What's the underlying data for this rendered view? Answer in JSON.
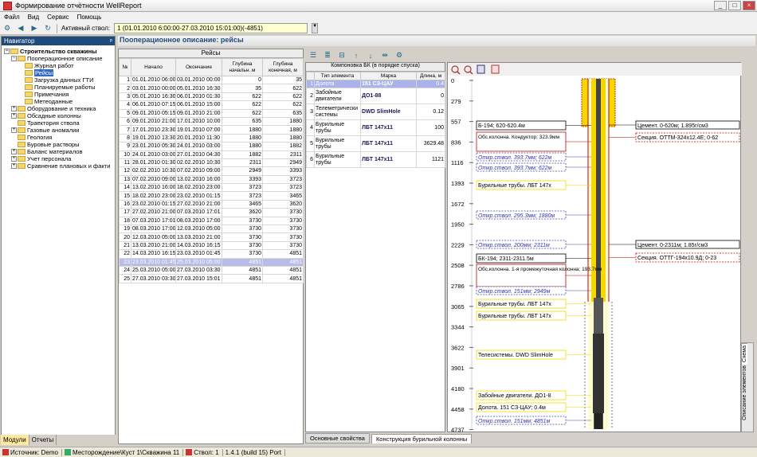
{
  "window": {
    "title": "Формирование отчётности WellReport"
  },
  "menu": [
    "Файл",
    "Вид",
    "Сервис",
    "Помощь"
  ],
  "toolbar": {
    "active_label": "Активный ствол:",
    "active_value": "1 (01.01.2010 6:00:00-27.03.2010 15:01:00)(-4851)"
  },
  "navigator": {
    "title": "Навигатор",
    "pin": "ᵖ",
    "items": [
      {
        "label": "Строительство скважины",
        "level": 0,
        "pm": "−",
        "bold": true
      },
      {
        "label": "Пооперационное описание",
        "level": 1,
        "pm": "−"
      },
      {
        "label": "Журнал работ",
        "level": 2
      },
      {
        "label": "Рейсы",
        "level": 2,
        "selected": true
      },
      {
        "label": "Загрузка данных ГТИ",
        "level": 2
      },
      {
        "label": "Планируемые работы",
        "level": 2
      },
      {
        "label": "Примечания",
        "level": 2
      },
      {
        "label": "Метеоданные",
        "level": 2
      },
      {
        "label": "Оборудование и техника",
        "level": 1,
        "pm": "+"
      },
      {
        "label": "Обсадные колонны",
        "level": 1,
        "pm": "+"
      },
      {
        "label": "Траектория ствола",
        "level": 1
      },
      {
        "label": "Газовые аномалии",
        "level": 1,
        "pm": "+"
      },
      {
        "label": "Геология",
        "level": 1
      },
      {
        "label": "Буровые растворы",
        "level": 1
      },
      {
        "label": "Баланс материалов",
        "level": 1,
        "pm": "+"
      },
      {
        "label": "Учет персонала",
        "level": 1,
        "pm": "+"
      },
      {
        "label": "Сравнение плановых и факти",
        "level": 1,
        "pm": "+"
      }
    ],
    "tabs": [
      "Модули",
      "Отчеты"
    ]
  },
  "page_title": "Пооперационное описание: рейсы",
  "trips": {
    "title": "Рейсы",
    "columns": [
      "№",
      "Начало",
      "Окончание",
      "Глубина начальн. м",
      "Глубина конечная, м"
    ],
    "rows": [
      [
        "1",
        "01.01.2010 06:00",
        "03.01.2010 00:00",
        "0",
        "35"
      ],
      [
        "2",
        "03.01.2010 00:00",
        "05.01.2010 16:30",
        "35",
        "622"
      ],
      [
        "3",
        "05.01.2010 16:30",
        "06.01.2010 01:30",
        "622",
        "622"
      ],
      [
        "4",
        "06.01.2010 07:15",
        "06.01.2010 15:00",
        "622",
        "622"
      ],
      [
        "5",
        "09.01.2010 05:15",
        "09.01.2010 21:00",
        "622",
        "635"
      ],
      [
        "6",
        "09.01.2010 21:00",
        "17.01.2010 10:00",
        "635",
        "1880"
      ],
      [
        "7",
        "17.01.2010 23:30",
        "19.01.2010 07:00",
        "1880",
        "1880"
      ],
      [
        "8",
        "19.01.2010 13:30",
        "20.01.2010 11:30",
        "1880",
        "1880"
      ],
      [
        "9",
        "23.01.2010 05:30",
        "24.01.2010 03:00",
        "1880",
        "1882"
      ],
      [
        "10",
        "24.01.2010 03:00",
        "27.01.2010 04:30",
        "1882",
        "2311"
      ],
      [
        "11",
        "28.01.2010 01:30",
        "02.02.2010 10:30",
        "2311",
        "2949"
      ],
      [
        "12",
        "02.02.2010 10:30",
        "07.02.2010 09:00",
        "2949",
        "3393"
      ],
      [
        "13",
        "07.02.2010 09:00",
        "13.02.2010 16:00",
        "3393",
        "3723"
      ],
      [
        "14",
        "13.02.2010 16:00",
        "18.02.2010 23:00",
        "3723",
        "3723"
      ],
      [
        "15",
        "18.02.2010 23:00",
        "23.02.2010 01:15",
        "3723",
        "3465"
      ],
      [
        "16",
        "23.02.2010 01:15",
        "27.02.2010 21:00",
        "3465",
        "3620"
      ],
      [
        "17",
        "27.02.2010 21:00",
        "07.03.2010 17:01",
        "3620",
        "3730"
      ],
      [
        "18",
        "07.03.2010 17:01",
        "08.03.2010 17:00",
        "3730",
        "3730"
      ],
      [
        "19",
        "08.03.2010 17:00",
        "12.03.2010 05:00",
        "3730",
        "3730"
      ],
      [
        "20",
        "12.03.2010 05:00",
        "13.03.2010 21:00",
        "3730",
        "3730"
      ],
      [
        "21",
        "13.03.2010 21:00",
        "14.03.2010 16:15",
        "3730",
        "3730"
      ],
      [
        "22",
        "14.03.2010 16:15",
        "23.03.2010 01:45",
        "3730",
        "4851"
      ],
      [
        "23",
        "23.03.2010 01:45",
        "25.03.2010 05:00",
        "4851",
        "4851"
      ],
      [
        "24",
        "25.03.2010 05:00",
        "27.03.2010 03:30",
        "4851",
        "4851"
      ],
      [
        "25",
        "27.03.2010 03:30",
        "27.03.2010 15:01",
        "4851",
        "4851"
      ]
    ],
    "selected_row": 22
  },
  "bha": {
    "title": "Компоновка БК (в порядке спуска)",
    "columns": [
      "",
      "Тип элемента",
      "Марка",
      "Длина, м"
    ],
    "rows": [
      [
        "1",
        "Долота",
        "151 СЗ-ЦАУ",
        "0.4"
      ],
      [
        "2",
        "Забойные двигатели",
        "ДО1-88",
        "0"
      ],
      [
        "3",
        "Телеметрически системы",
        "DWD SlimHole",
        "0.12"
      ],
      [
        "4",
        "Бурильные трубы",
        "ЛБТ 147х11",
        "100"
      ],
      [
        "5",
        "Бурильные трубы",
        "ЛБТ 147х11",
        "3629.48"
      ],
      [
        "6",
        "Бурильные трубы",
        "ЛБТ 147х11",
        "1121"
      ]
    ],
    "selected_row": 0
  },
  "scheme": {
    "depths": [
      "0",
      "279",
      "557",
      "836",
      "1116",
      "1393",
      "1672",
      "1950",
      "2229",
      "2508",
      "2786",
      "3065",
      "3344",
      "3622",
      "3901",
      "4180",
      "4458",
      "4737"
    ],
    "labels": {
      "b194": "Б-194; 620-620.4м",
      "casing1": "Обс.колонна. Кондуктор; 323.9мм",
      "hole393a": "Откр.ствол. 393.7мм; 622м",
      "hole393b": "Откр.ствол. 393.7мм; 622м",
      "pipe1": "Бурильные трубы. ЛБТ 147х",
      "hole295": "Откр.ствол. 295.3мм; 1880м",
      "hole200": "Откр.ствол. 200мм; 2311м",
      "bk194": "БК-194; 2311-2311.5м",
      "casing2": "Обс.колонна. 1-я промежуточная колонна; 193.7мм",
      "hole151a": "Откр.ствол. 151мм; 2949м",
      "pipe2": "Бурильные трубы. ЛБТ 147х",
      "pipe3": "Бурильные трубы. ЛБТ 147х",
      "tele": "Телесистемы. DWD SlimHole",
      "motor": "Забойные двигатели. ДО1-8",
      "bit": "Долота. 151 СЗ-ЦАУ; 0.4м",
      "hole151b": "Откр.ствол. 151мм; 4851м",
      "cem1": "Цемент. 0-620м; 1.895г/см3",
      "sec1": "Секция. ОТТМ-324х12.4Е; 0-62",
      "cem2": "Цемент. 0-2311м; 1.85г/см3",
      "sec2": "Секция. ОТТГ-194х10.9Д; 0-23"
    }
  },
  "side_tabs": [
    "Схема",
    "Описание элементов"
  ],
  "bottom_tabs": [
    "Основные свойства",
    "Конструкция бурильной колонны"
  ],
  "status": {
    "source": "Источник: Demo",
    "field": "Месторождение\\Куст 1\\Скважина 11",
    "bore": "Ствол: 1",
    "version": "1.4.1 (build 15) Port"
  },
  "colors": {
    "nav_header": "#1f4a7c",
    "selected_row": "#b9bce6",
    "accent_yellow": "#f5d800",
    "accent_red": "#c00000"
  }
}
